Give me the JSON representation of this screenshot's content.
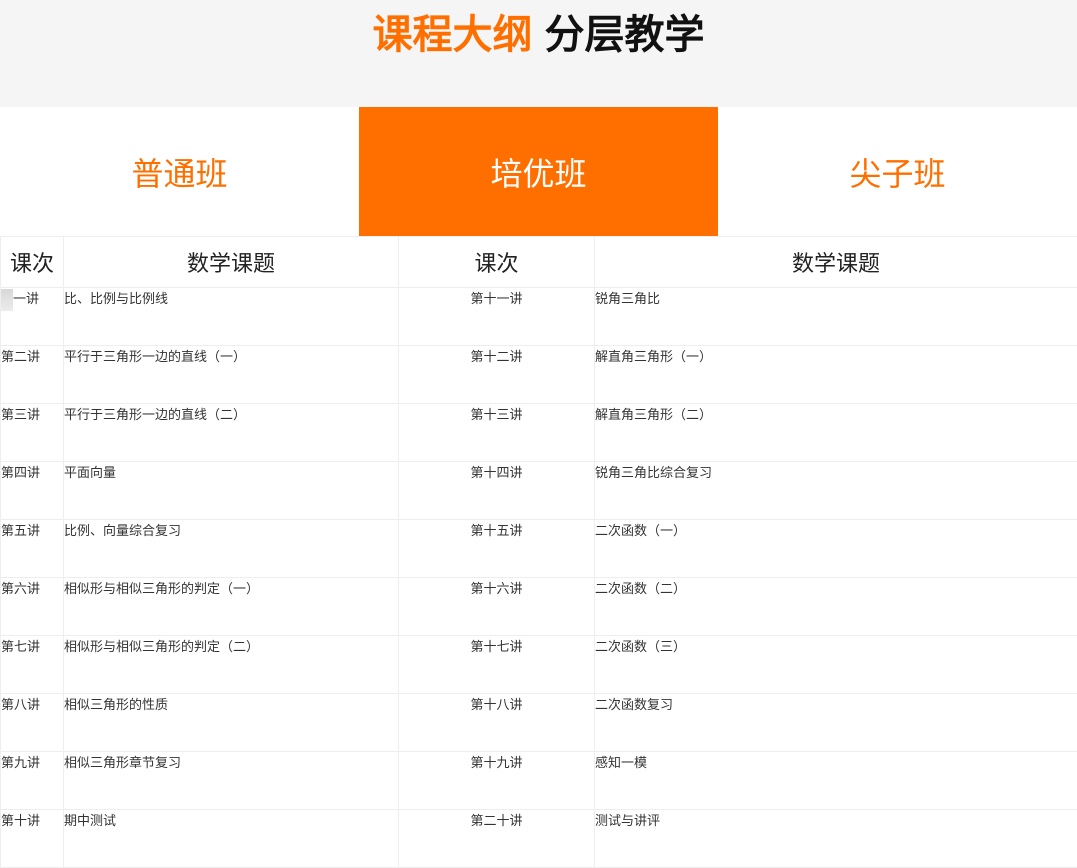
{
  "header": {
    "title_orange": "课程大纲",
    "title_black": "分层教学"
  },
  "tabs": [
    {
      "label": "普通班",
      "active": false
    },
    {
      "label": "培优班",
      "active": true
    },
    {
      "label": "尖子班",
      "active": false
    }
  ],
  "table": {
    "headers": [
      "课次",
      "数学课题",
      "课次",
      "数学课题"
    ],
    "rows": [
      {
        "l1": "一讲",
        "t1": "比、比例与比例线",
        "l2": "第十一讲",
        "t2": "锐角三角比"
      },
      {
        "l1": "第二讲",
        "t1": "平行于三角形一边的直线（一）",
        "l2": "第十二讲",
        "t2": "解直角三角形（一）"
      },
      {
        "l1": "第三讲",
        "t1": "平行于三角形一边的直线（二）",
        "l2": "第十三讲",
        "t2": "解直角三角形（二）"
      },
      {
        "l1": "第四讲",
        "t1": "平面向量",
        "l2": "第十四讲",
        "t2": "锐角三角比综合复习"
      },
      {
        "l1": "第五讲",
        "t1": "比例、向量综合复习",
        "l2": "第十五讲",
        "t2": "二次函数（一）"
      },
      {
        "l1": "第六讲",
        "t1": "相似形与相似三角形的判定（一）",
        "l2": "第十六讲",
        "t2": "二次函数（二）"
      },
      {
        "l1": "第七讲",
        "t1": "相似形与相似三角形的判定（二）",
        "l2": "第十七讲",
        "t2": "二次函数（三）"
      },
      {
        "l1": "第八讲",
        "t1": "相似三角形的性质",
        "l2": "第十八讲",
        "t2": "二次函数复习"
      },
      {
        "l1": "第九讲",
        "t1": "相似三角形章节复习",
        "l2": "第十九讲",
        "t2": "感知一模"
      },
      {
        "l1": "第十讲",
        "t1": "期中测试",
        "l2": "第二十讲",
        "t2": "测试与讲评"
      }
    ]
  },
  "colors": {
    "accent": "#ff6f00",
    "header_bg": "#f5f5f5",
    "border": "#eeeeee"
  }
}
